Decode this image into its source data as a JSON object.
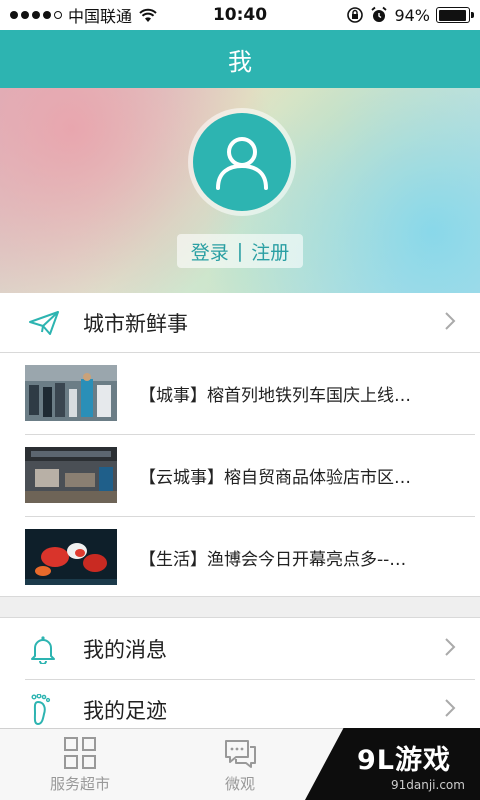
{
  "status_bar": {
    "carrier": "中国联通",
    "time": "10:40",
    "battery_text": "94%",
    "battery_level": 0.94
  },
  "header": {
    "title": "我"
  },
  "profile": {
    "login_label": "登录",
    "separator": "|",
    "register_label": "注册"
  },
  "city_news": {
    "label": "城市新鲜事",
    "items": [
      {
        "text": "【城事】榕首列地铁列车国庆上线…"
      },
      {
        "text": "【云城事】榕自贸商品体验店市区…"
      },
      {
        "text": "【生活】渔博会今日开幕亮点多--…"
      }
    ]
  },
  "menu": {
    "messages_label": "我的消息",
    "footprints_label": "我的足迹"
  },
  "tabbar": {
    "tabs": [
      {
        "label": "服务超市"
      },
      {
        "label": "微观"
      }
    ]
  },
  "watermark": {
    "brand": "9L游戏",
    "site": "91danji.com"
  },
  "colors": {
    "accent": "#2db4b1",
    "link": "#2a9fa3"
  },
  "icons": [
    "wifi-icon",
    "lock-rotation-icon",
    "alarm-icon",
    "user-avatar-icon",
    "paper-plane-icon",
    "chevron-right-icon",
    "bell-icon",
    "footprint-icon",
    "grid-icon",
    "chat-bubbles-icon"
  ]
}
